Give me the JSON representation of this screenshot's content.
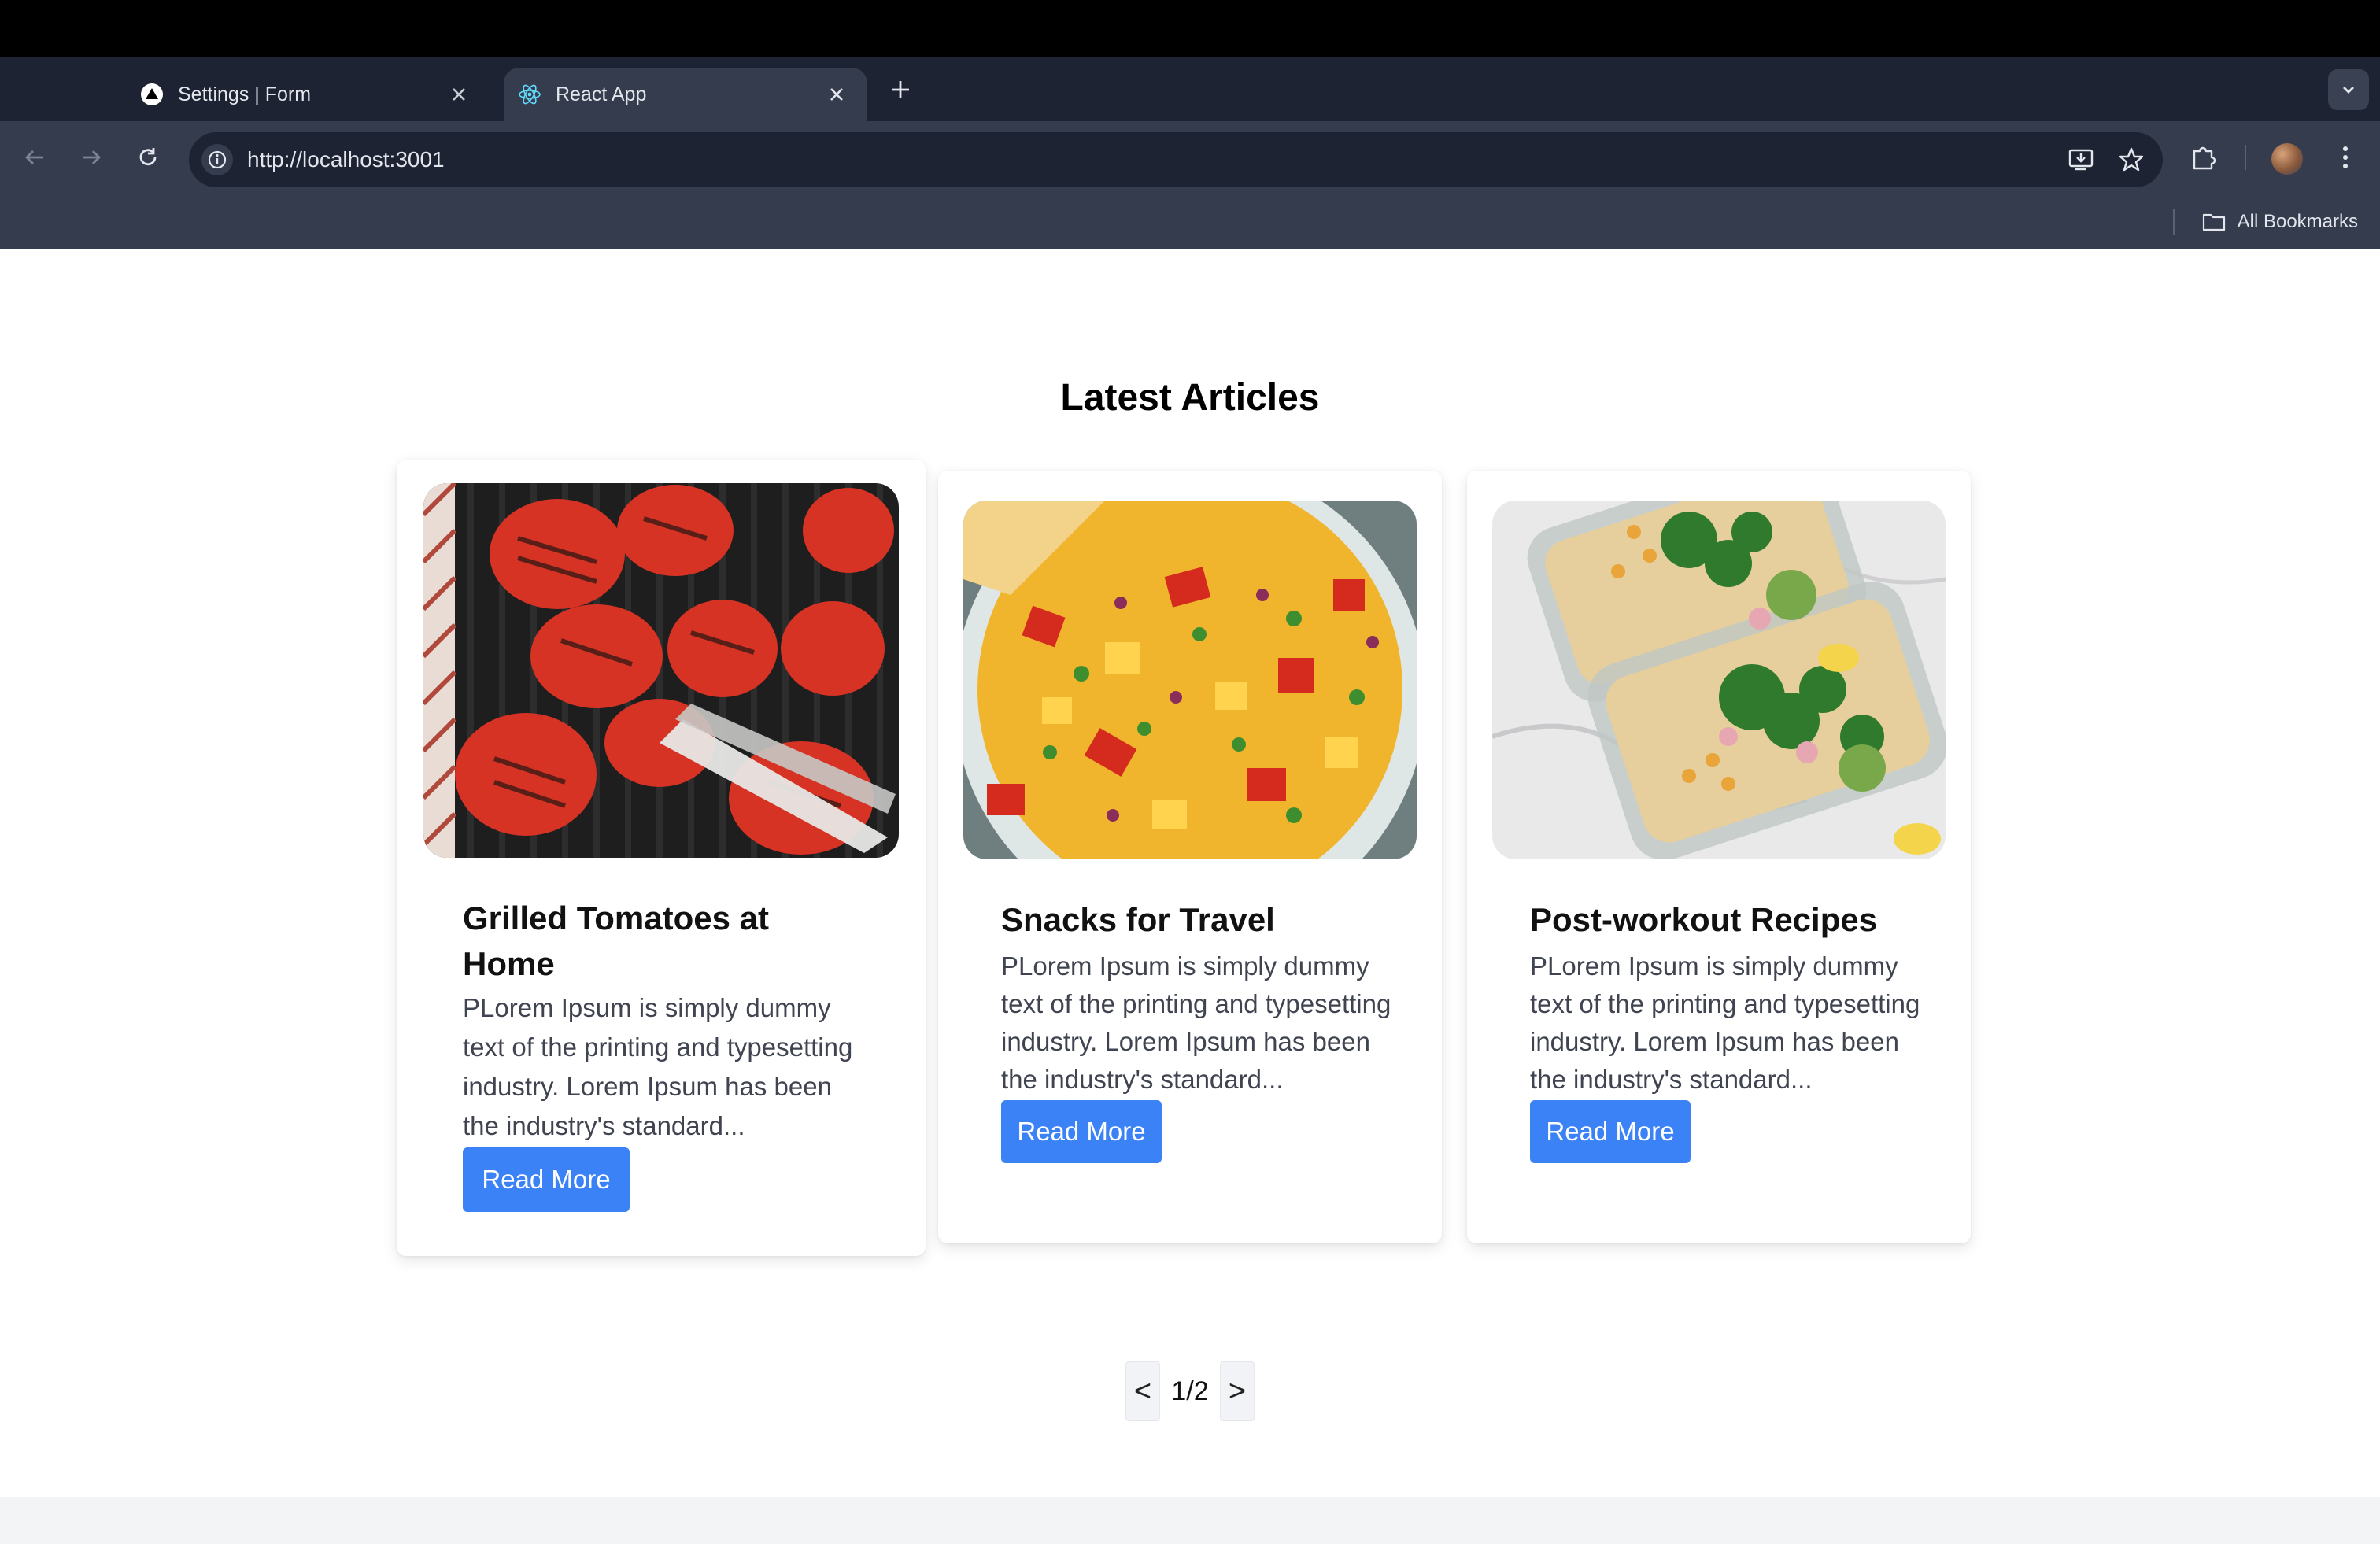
{
  "browser": {
    "tabs": [
      {
        "title": "Settings | Form",
        "favicon": "triangle-logo-icon",
        "active": false
      },
      {
        "title": "React App",
        "favicon": "react-logo-icon",
        "active": true
      }
    ],
    "url": "http://localhost:3001",
    "bookmarks_label": "All Bookmarks"
  },
  "page": {
    "title": "Latest Articles",
    "articles": [
      {
        "title_line1": "Grilled Tomatoes at",
        "title_line2": "Home",
        "excerpt": "PLorem Ipsum is simply dummy text of the printing and typesetting industry. Lorem Ipsum has been the industry's standard...",
        "button": "Read More",
        "image": "grilled-tomatoes-photo"
      },
      {
        "title_line1": "Snacks for Travel",
        "excerpt": "PLorem Ipsum is simply dummy text of the printing and typesetting industry. Lorem Ipsum has been the industry's standard...",
        "button": "Read More",
        "image": "fruit-salsa-photo"
      },
      {
        "title_line1": "Post-workout Recipes",
        "excerpt": "PLorem Ipsum is simply dummy text of the printing and typesetting industry. Lorem Ipsum has been the industry's standard...",
        "button": "Read More",
        "image": "meal-prep-photo"
      }
    ],
    "pagination": {
      "prev": "<",
      "label": "1/2",
      "next": ">"
    }
  },
  "colors": {
    "accent": "#3b82f6",
    "chrome_dark": "#1d2332",
    "chrome": "#353c4e"
  }
}
